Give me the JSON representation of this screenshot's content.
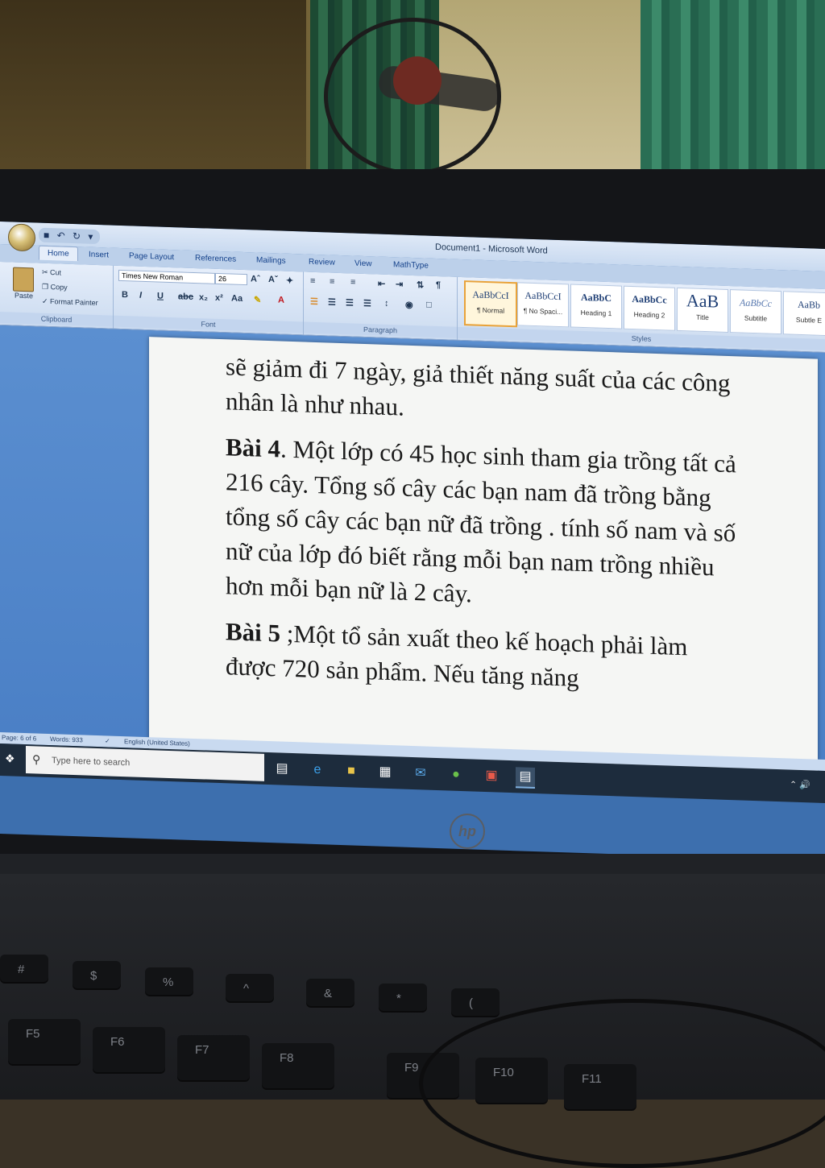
{
  "window": {
    "title": "Document1 - Microsoft Word",
    "qat_buttons": [
      "save-icon",
      "undo-icon",
      "redo-icon"
    ]
  },
  "ribbon": {
    "tabs": [
      "Home",
      "Insert",
      "Page Layout",
      "References",
      "Mailings",
      "Review",
      "View",
      "MathType"
    ],
    "active_tab": "Home",
    "clipboard": {
      "paste": "Paste",
      "cut": "Cut",
      "copy": "Copy",
      "format_painter": "Format Painter",
      "label": "Clipboard"
    },
    "font": {
      "family": "Times New Roman",
      "size": "26",
      "label": "Font"
    },
    "paragraph": {
      "label": "Paragraph"
    },
    "styles": {
      "label": "Styles",
      "items": [
        {
          "sample": "AaBbCcI",
          "name": "¶ Normal"
        },
        {
          "sample": "AaBbCcI",
          "name": "¶ No Spaci..."
        },
        {
          "sample": "AaBbC",
          "name": "Heading 1"
        },
        {
          "sample": "AaBbCc",
          "name": "Heading 2"
        },
        {
          "sample": "AaB",
          "name": "Title"
        },
        {
          "sample": "AaBbCc",
          "name": "Subtitle"
        },
        {
          "sample": "AaBb",
          "name": "Subtle E"
        }
      ]
    }
  },
  "document": {
    "p1": "sẽ giảm đi 7 ngày, giả thiết năng suất của các công nhân là như nhau.",
    "p2_head": "Bài 4",
    "p2_body": ". Một lớp có 45 học sinh tham gia trồng tất cả 216 cây. Tổng số cây các bạn nam đã trồng bằng tổng số cây các bạn nữ đã trồng . tính số nam và số nữ của lớp đó biết rằng mỗi bạn nam trồng nhiều hơn mỗi bạn nữ là 2 cây.",
    "p3_head": "Bài 5",
    "p3_body": " ;Một tổ sản xuất theo kế hoạch phải làm được 720 sản phẩm. Nếu tăng năng"
  },
  "statusbar": {
    "page": "Page: 6 of 6",
    "words": "Words: 933",
    "language": "English (United States)"
  },
  "taskbar": {
    "search_placeholder": "Type here to search"
  },
  "keyboard": {
    "f_keys": [
      "F5",
      "F6",
      "F7",
      "F8",
      "F9",
      "F10",
      "F11"
    ],
    "brand": "hp"
  }
}
